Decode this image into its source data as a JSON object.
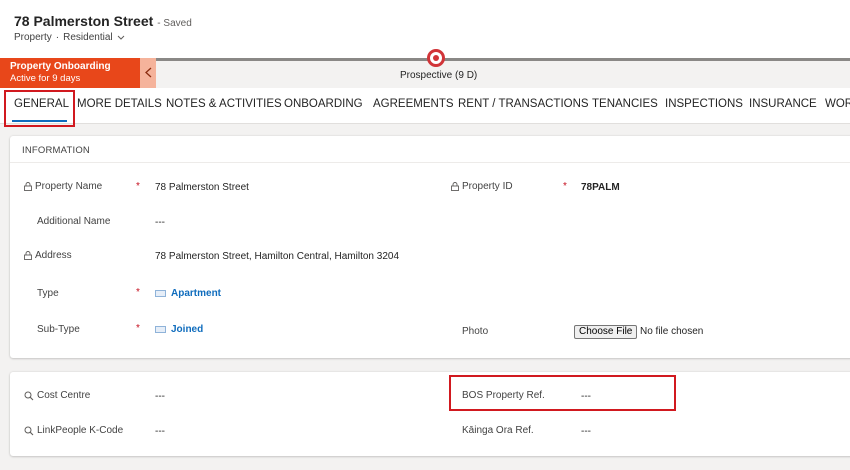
{
  "header": {
    "title": "78 Palmerston Street",
    "saved": "- Saved",
    "entity": "Property",
    "separator": "·",
    "form": "Residential"
  },
  "process": {
    "active_stage": "Property Onboarding",
    "active_duration": "Active for 9 days",
    "current_stage_label": "Prospective  (9 D)"
  },
  "tabs": [
    "GENERAL",
    "MORE DETAILS",
    "NOTES & ACTIVITIES",
    "ONBOARDING",
    "AGREEMENTS",
    "RENT / TRANSACTIONS",
    "TENANCIES",
    "INSPECTIONS",
    "INSURANCE",
    "WOR"
  ],
  "information": {
    "section_title": "INFORMATION",
    "property_name_label": "Property Name",
    "property_name_value": "78 Palmerston Street",
    "property_id_label": "Property ID",
    "property_id_value": "78PALM",
    "additional_name_label": "Additional Name",
    "additional_name_value": "---",
    "address_label": "Address",
    "address_value": "78 Palmerston Street, Hamilton Central, Hamilton 3204",
    "type_label": "Type",
    "type_value": "Apartment",
    "subtype_label": "Sub-Type",
    "subtype_value": "Joined",
    "photo_label": "Photo",
    "photo_button": "Choose File",
    "photo_status": "No file chosen",
    "required_mark": "*"
  },
  "codes": {
    "cost_centre_label": "Cost Centre",
    "cost_centre_value": "---",
    "bos_ref_label": "BOS Property Ref.",
    "bos_ref_value": "---",
    "linkpeople_label": "LinkPeople K-Code",
    "linkpeople_value": "---",
    "kainga_label": "Kāinga Ora Ref.",
    "kainga_value": "---"
  },
  "colors": {
    "stage_active": "#e8471a",
    "highlight": "#d1191f",
    "link": "#0f6cbd",
    "required": "#c50f1f"
  },
  "icons": [
    "lock-icon",
    "lookup-icon",
    "entity-icon",
    "chevron-left-icon",
    "chevron-down-icon",
    "stage-node-icon"
  ]
}
